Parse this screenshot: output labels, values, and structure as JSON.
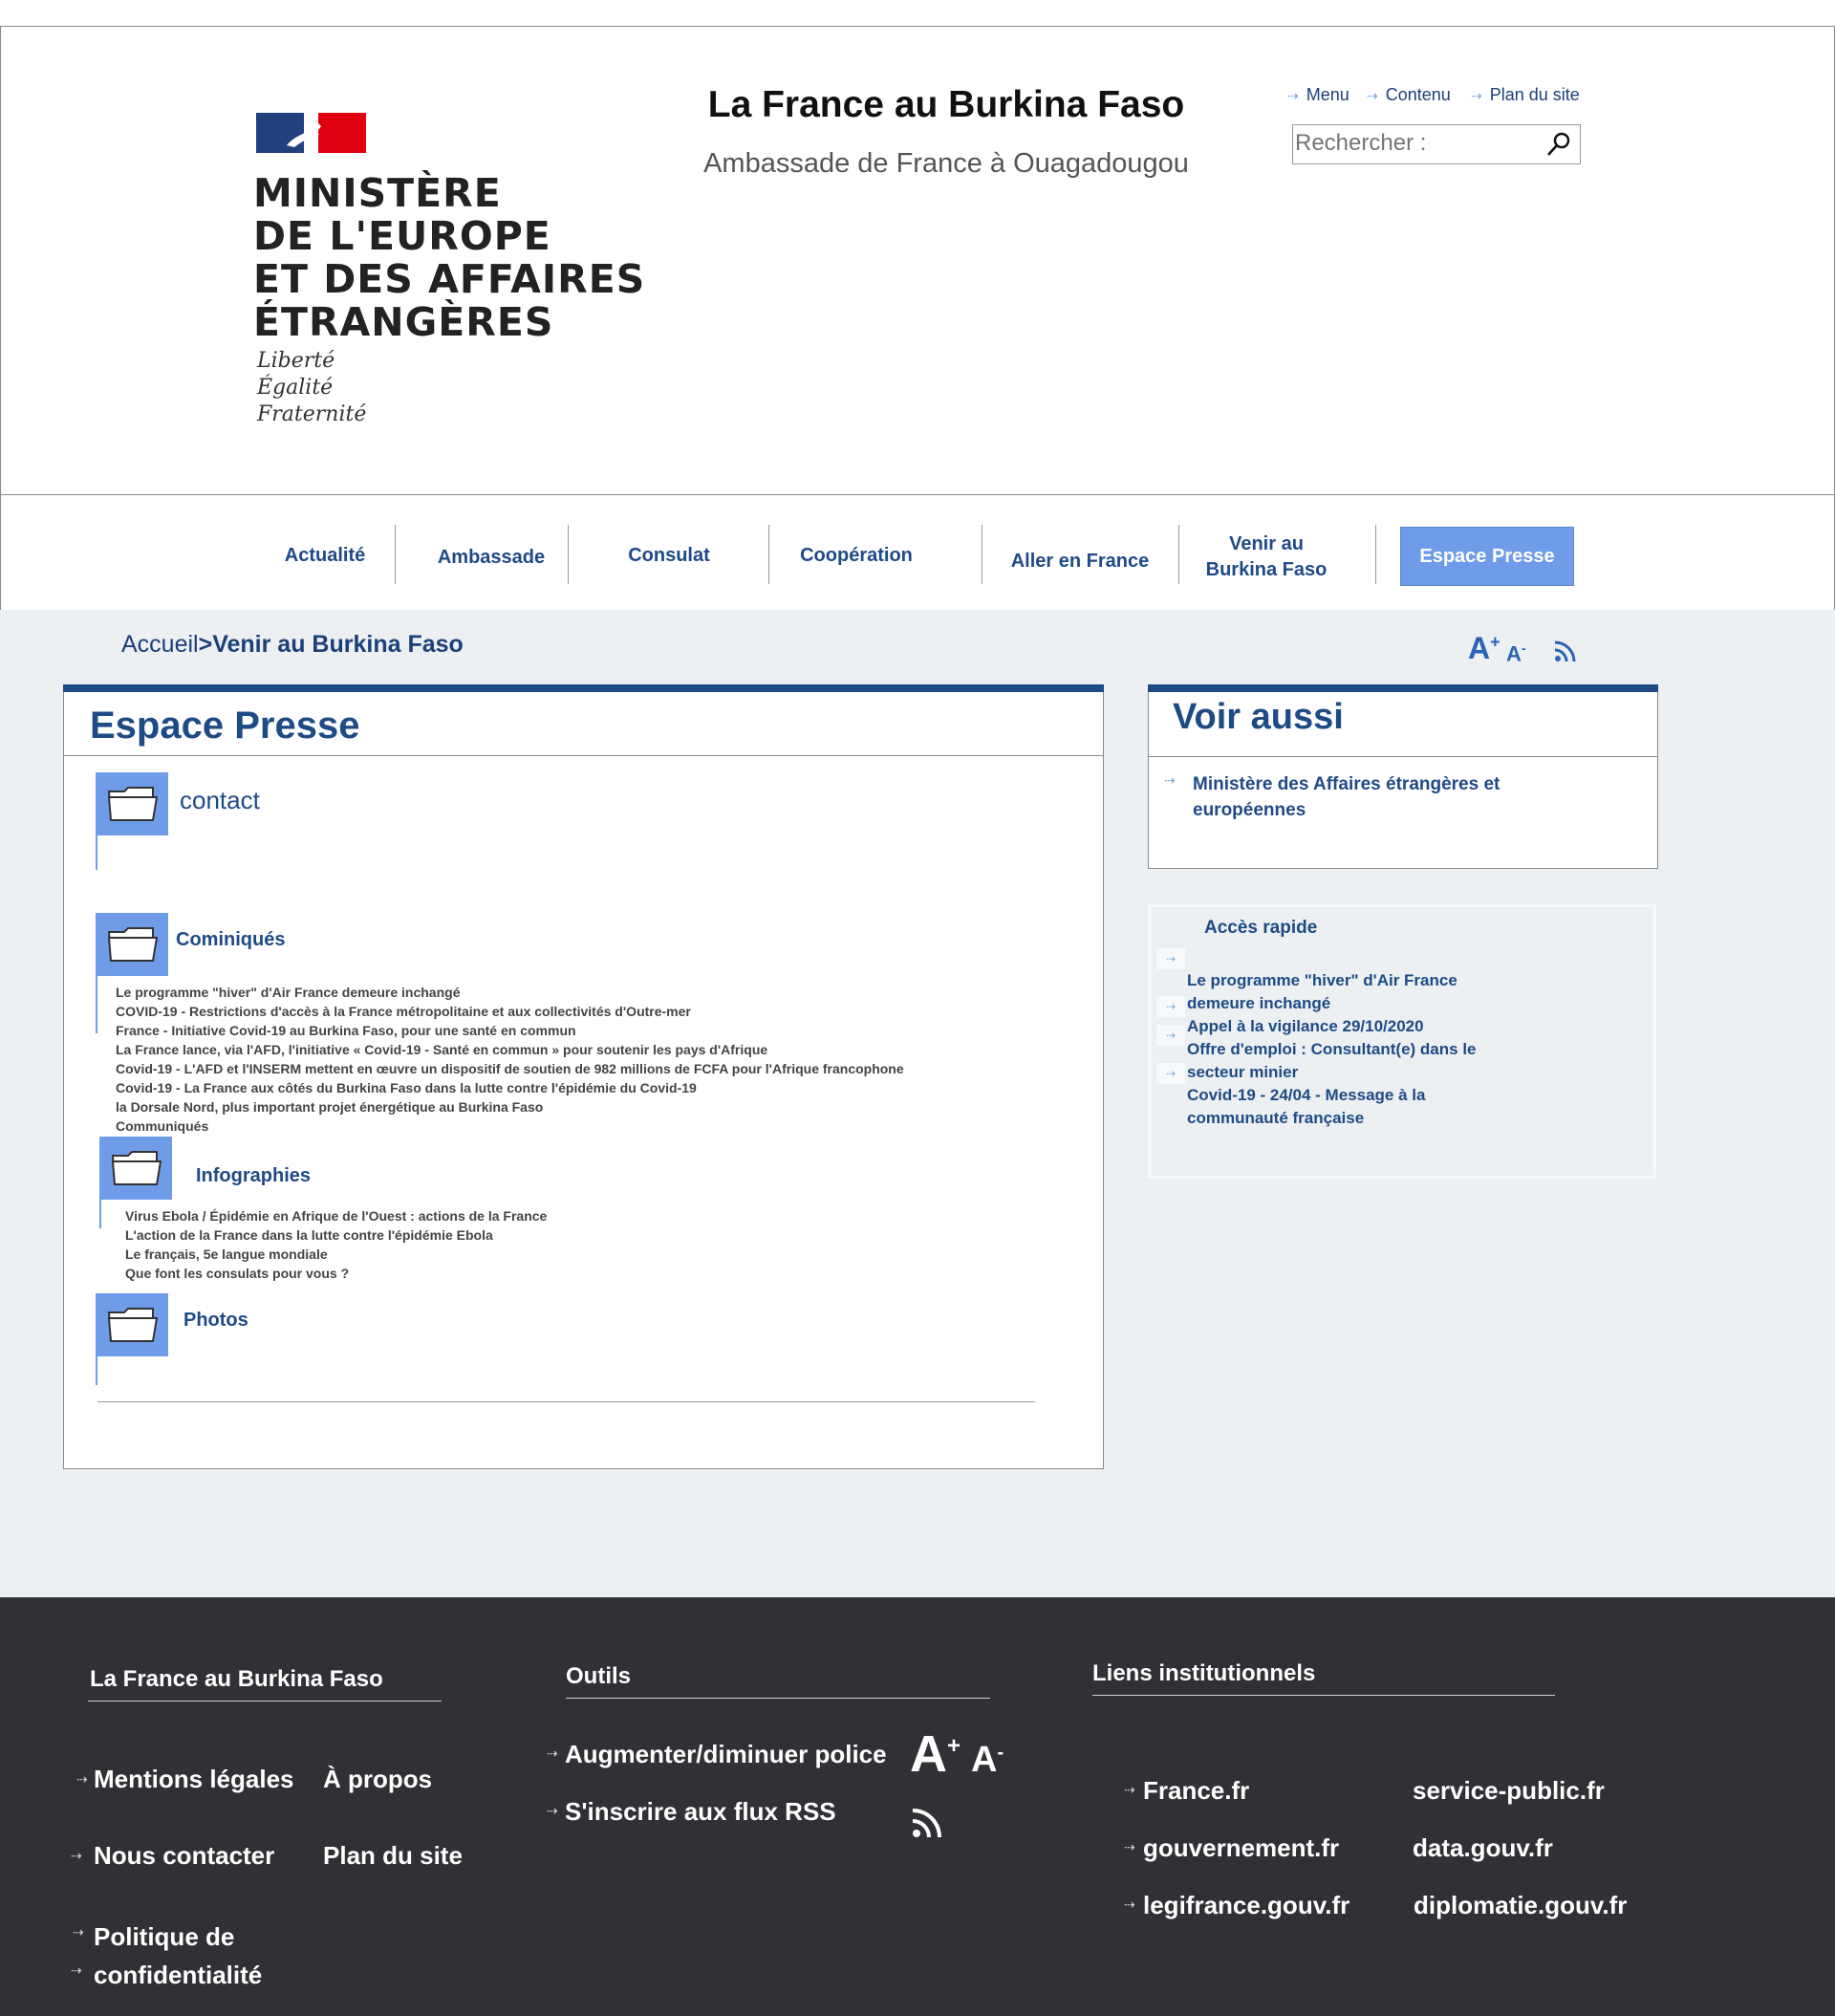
{
  "header": {
    "ministry_lines": [
      "MINISTÈRE",
      "DE L'EUROPE",
      "ET DES AFFAIRES",
      "ÉTRANGÈRES"
    ],
    "motto": [
      "Liberté",
      "Égalité",
      "Fraternité"
    ],
    "site_title": "La France au Burkina Faso",
    "site_subtitle": "Ambassade de France à Ouagadougou",
    "top_links": [
      "Menu",
      "Contenu",
      "Plan du site"
    ],
    "search_placeholder": "Rechercher :",
    "flag_colors": {
      "blue": "#22407e",
      "red": "#e1000f"
    }
  },
  "nav": {
    "items": [
      "Actualité",
      "Ambassade",
      "Consulat",
      "Coopération",
      "Aller en France",
      "Venir au Burkina Faso"
    ],
    "active": "Espace Presse"
  },
  "breadcrumb": {
    "home": "Accueil",
    "separator": ">",
    "current": "Venir au Burkina Faso"
  },
  "tools": {
    "font_increase": "A",
    "font_decrease": "A",
    "plus": "+",
    "minus": "-",
    "rss": "rss-icon"
  },
  "main": {
    "title": "Espace Presse",
    "sections": [
      {
        "title": "contact",
        "items": []
      },
      {
        "title": "Cominiqués",
        "items": [
          "Le programme \"hiver\" d'Air France demeure inchangé",
          "COVID-19 - Restrictions d'accès à la France métropolitaine et aux collectivités d'Outre-mer",
          "France - Initiative Covid-19 au Burkina Faso, pour une santé en commun",
          "La France lance, via l'AFD, l'initiative « Covid-19 - Santé en commun » pour soutenir les pays d'Afrique",
          "Covid-19 - L'AFD et l'INSERM mettent en œuvre un dispositif de soutien de 982 millions de FCFA pour l'Afrique francophone",
          "Covid-19 - La France aux côtés du Burkina Faso dans la lutte contre l'épidémie du Covid-19",
          "la Dorsale Nord, plus important projet énergétique au Burkina Faso",
          "Communiqués"
        ]
      },
      {
        "title": "Infographies",
        "items": [
          "Virus Ebola / Épidémie en Afrique de l'Ouest : actions de la France",
          "L'action de la France dans la lutte contre l'épidémie Ebola",
          "Le français, 5e langue mondiale",
          "Que font les consulats pour vous ?"
        ]
      },
      {
        "title": "Photos",
        "items": []
      }
    ]
  },
  "voir_aussi": {
    "title": "Voir aussi",
    "links": [
      "Ministère des Affaires étrangères et européennes"
    ]
  },
  "acces_rapide": {
    "title": "Accès rapide",
    "links": [
      "Le programme \"hiver\" d'Air France demeure inchangé",
      "Appel à la vigilance 29/10/2020",
      "Offre d'emploi : Consultant(e) dans le secteur minier",
      "Covid-19 - 24/04 - Message à la communauté française"
    ]
  },
  "footer": {
    "col1": {
      "title": "La France au Burkina Faso",
      "links": [
        "Mentions légales",
        "À propos",
        "Nous contacter",
        "Plan du site",
        "Politique de confidentialité"
      ]
    },
    "col2": {
      "title": "Outils",
      "links": [
        "Augmenter/diminuer police",
        "S'inscrire aux flux RSS"
      ]
    },
    "col3": {
      "title": "Liens institutionnels",
      "links": [
        "France.fr",
        "service-public.fr",
        "gouvernement.fr",
        "data.gouv.fr",
        "legifrance.gouv.fr",
        "diplomatie.gouv.fr"
      ]
    }
  },
  "colors": {
    "brand_blue": "#1e4a86",
    "accent_blue": "#6f9ce8",
    "footer_bg": "#303035",
    "content_bg": "#ecf0f2"
  }
}
